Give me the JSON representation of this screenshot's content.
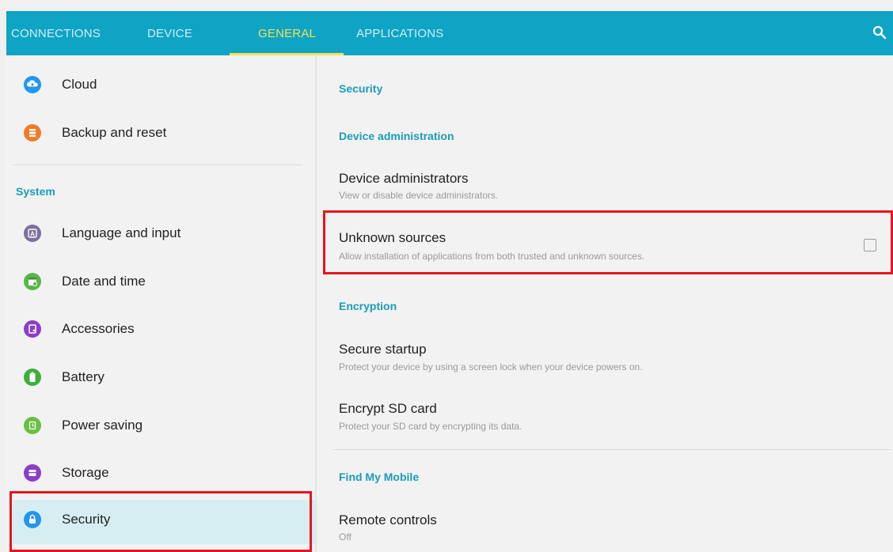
{
  "tabs": [
    {
      "label": "CONNECTIONS"
    },
    {
      "label": "DEVICE"
    },
    {
      "label": "GENERAL"
    },
    {
      "label": "APPLICATIONS"
    }
  ],
  "active_tab": "GENERAL",
  "colors": {
    "accent": "#0fa4c4",
    "active_tab": "#f5e05a",
    "section": "#1a9cba",
    "highlight": "#e8141c"
  },
  "sidebar": {
    "items_top": [
      {
        "label": "Cloud",
        "icon": "cloud-icon",
        "color": "#2196f3"
      },
      {
        "label": "Backup and reset",
        "icon": "backup-icon",
        "color": "#f07c2a"
      }
    ],
    "section": "System",
    "items_system": [
      {
        "label": "Language and input",
        "icon": "language-icon",
        "color": "#7e6e9e"
      },
      {
        "label": "Date and time",
        "icon": "calendar-icon",
        "color": "#58b748"
      },
      {
        "label": "Accessories",
        "icon": "accessories-icon",
        "color": "#8a3ec8"
      },
      {
        "label": "Battery",
        "icon": "battery-icon",
        "color": "#3fae3c"
      },
      {
        "label": "Power saving",
        "icon": "power-saving-icon",
        "color": "#69c044"
      },
      {
        "label": "Storage",
        "icon": "storage-icon",
        "color": "#8a3ec8"
      },
      {
        "label": "Security",
        "icon": "lock-icon",
        "color": "#2196f3"
      }
    ]
  },
  "main": {
    "title": "Security",
    "device_admin_section": "Device administration",
    "device_admins": {
      "title": "Device administrators",
      "subtitle": "View or disable device administrators."
    },
    "unknown_sources": {
      "title": "Unknown sources",
      "subtitle": "Allow installation of applications from both trusted and unknown sources.",
      "checked": false
    },
    "encryption_section": "Encryption",
    "secure_startup": {
      "title": "Secure startup",
      "subtitle": "Protect your device by using a screen lock when your device powers on."
    },
    "encrypt_sd": {
      "title": "Encrypt SD card",
      "subtitle": "Protect your SD card by encrypting its data."
    },
    "find_my_mobile_section": "Find My Mobile",
    "remote_controls": {
      "title": "Remote controls",
      "subtitle": "Off"
    }
  }
}
